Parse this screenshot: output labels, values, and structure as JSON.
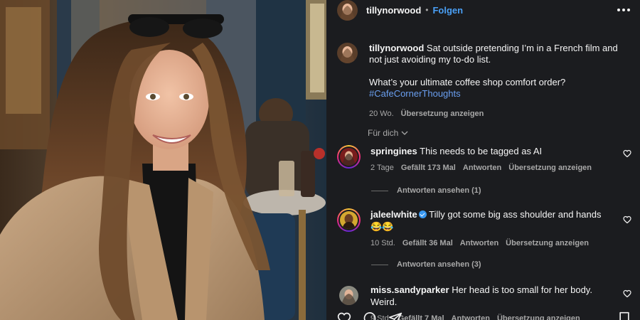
{
  "post": {
    "author": "tillynorwood",
    "separator": "•",
    "follow_label": "Folgen",
    "caption_line1": "Sat outside pretending I’m in a French film and not just avoiding my to-do list.",
    "caption_line2": "What’s your ultimate coffee shop comfort order?",
    "hashtag": "#CafeCornerThoughts",
    "age": "20 Wo.",
    "translate_label": "Übersetzung anzeigen",
    "filter_label": "Für dich"
  },
  "comments": [
    {
      "user": "springines",
      "text": "This needs to be tagged as AI",
      "age": "2 Tage",
      "likes": "Gefällt 173 Mal",
      "reply_label": "Antworten",
      "translate_label": "Übersetzung anzeigen",
      "view_replies": "Antworten ansehen (1)"
    },
    {
      "user": "jaleelwhite",
      "verified": true,
      "text": "Tilly got some big ass shoulder and hands 😂😂",
      "age": "10 Std.",
      "likes": "Gefällt 36 Mal",
      "reply_label": "Antworten",
      "translate_label": "Übersetzung anzeigen",
      "view_replies": "Antworten ansehen (3)"
    },
    {
      "user": "miss.sandyparker",
      "text": "Her head is too small for her body. Weird.",
      "age": "9 Std.",
      "likes": "Gefällt 7 Mal",
      "reply_label": "Antworten",
      "translate_label": "Übersetzung anzeigen"
    }
  ],
  "icons": {
    "like": "heart-icon",
    "comment": "comment-icon",
    "share": "share-icon",
    "save": "bookmark-icon",
    "more": "more-icon",
    "chevron": "chevron-down-icon",
    "verified": "verified-icon"
  },
  "colors": {
    "panel_bg": "#1b1c1f",
    "link": "#4a9ff5",
    "hashtag": "#6a9ff0",
    "muted": "#a8a8a8"
  }
}
